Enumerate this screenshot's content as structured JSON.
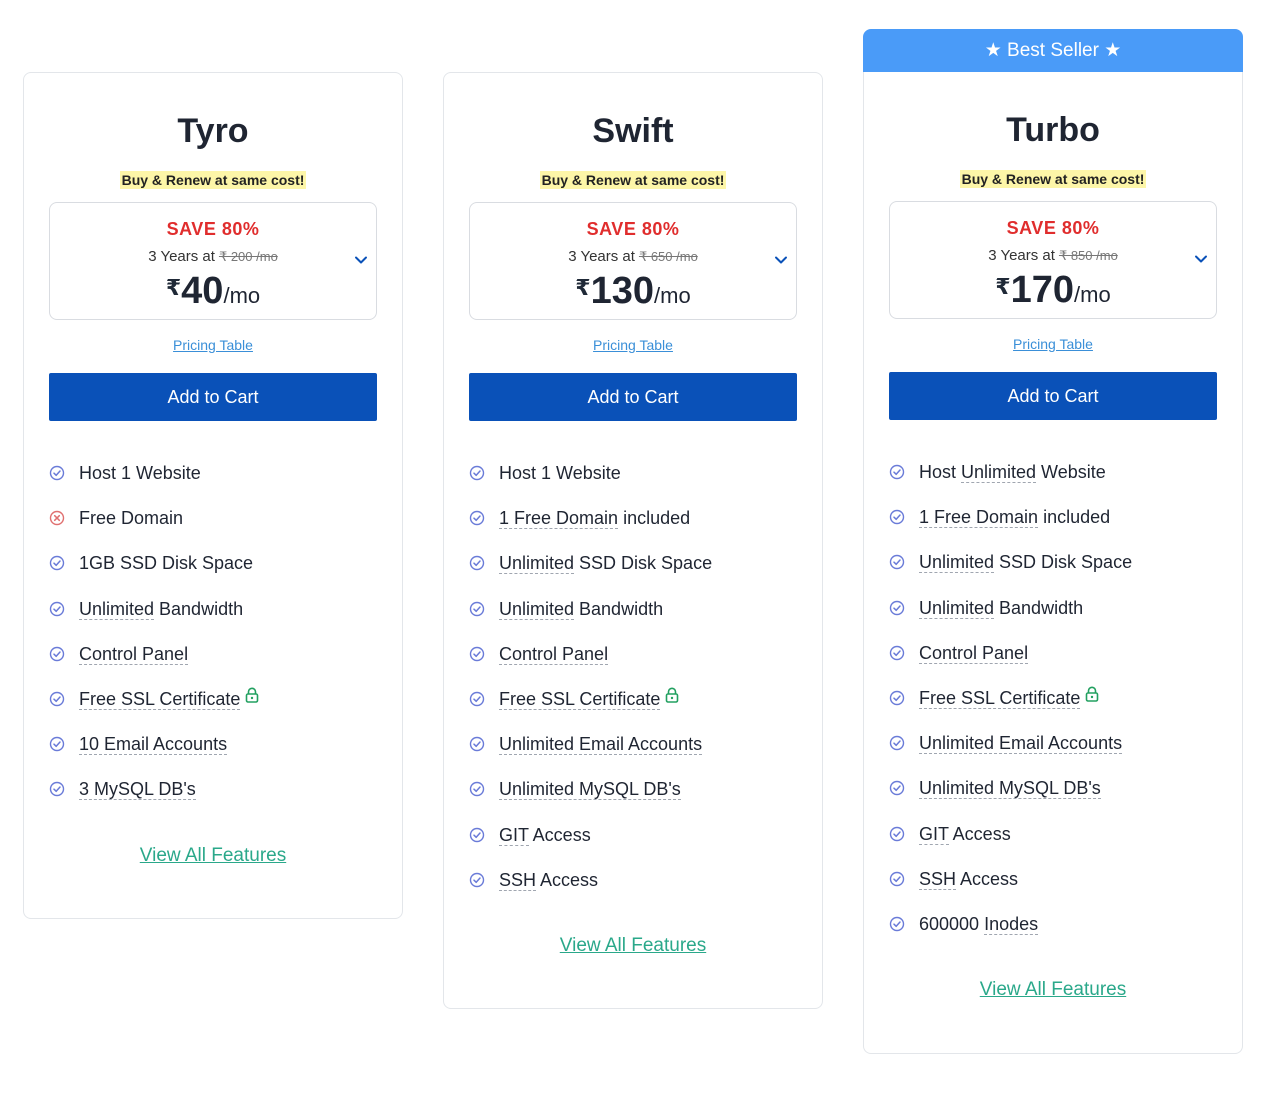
{
  "ribbon": {
    "text": "★ Best Seller ★"
  },
  "plans": [
    {
      "name": "Tyro",
      "tagline": "Buy & Renew at same cost!",
      "save": "SAVE 80%",
      "term": "3 Years at",
      "old_price": "₹ 200 /mo",
      "currency": "₹",
      "price": "40",
      "per": "/mo",
      "pricing_link": "Pricing Table",
      "cart_label": "Add to Cart",
      "view_all": "View All Features",
      "features": [
        {
          "pre": "Host 1 Website",
          "ul": "",
          "post": "",
          "icon": "check"
        },
        {
          "pre": "Free Domain",
          "ul": "",
          "post": "",
          "icon": "cross"
        },
        {
          "pre": "1GB SSD Disk Space",
          "ul": "",
          "post": "",
          "icon": "check"
        },
        {
          "pre": "",
          "ul": "Unlimited",
          "post": " Bandwidth",
          "icon": "check"
        },
        {
          "pre": "",
          "ul": "Control Panel",
          "post": "",
          "icon": "check"
        },
        {
          "pre": "",
          "ul": "Free SSL Certificate",
          "post": "",
          "icon": "check",
          "lock": true
        },
        {
          "pre": "",
          "ul": "10 Email Accounts",
          "post": "",
          "icon": "check"
        },
        {
          "pre": "",
          "ul": "3 MySQL DB's",
          "post": "",
          "icon": "check"
        }
      ]
    },
    {
      "name": "Swift",
      "tagline": "Buy & Renew at same cost!",
      "save": "SAVE 80%",
      "term": "3 Years at",
      "old_price": "₹ 650 /mo",
      "currency": "₹",
      "price": "130",
      "per": "/mo",
      "pricing_link": "Pricing Table",
      "cart_label": "Add to Cart",
      "view_all": "View All Features",
      "features": [
        {
          "pre": "Host 1 Website",
          "ul": "",
          "post": "",
          "icon": "check"
        },
        {
          "pre": "",
          "ul": "1 Free Domain",
          "post": " included",
          "icon": "check"
        },
        {
          "pre": "",
          "ul": "Unlimited",
          "post": " SSD Disk Space",
          "icon": "check"
        },
        {
          "pre": "",
          "ul": "Unlimited",
          "post": " Bandwidth",
          "icon": "check"
        },
        {
          "pre": "",
          "ul": "Control Panel",
          "post": "",
          "icon": "check"
        },
        {
          "pre": "",
          "ul": "Free SSL Certificate",
          "post": "",
          "icon": "check",
          "lock": true
        },
        {
          "pre": "",
          "ul": "Unlimited Email Accounts",
          "post": "",
          "icon": "check"
        },
        {
          "pre": "",
          "ul": "Unlimited MySQL DB's",
          "post": "",
          "icon": "check"
        },
        {
          "pre": "",
          "ul": "GIT",
          "post": " Access",
          "icon": "check"
        },
        {
          "pre": "",
          "ul": "SSH",
          "post": " Access",
          "icon": "check"
        }
      ]
    },
    {
      "name": "Turbo",
      "tagline": "Buy & Renew at same cost!",
      "save": "SAVE 80%",
      "term": "3 Years at",
      "old_price": "₹ 850 /mo",
      "currency": "₹",
      "price": "170",
      "per": "/mo",
      "pricing_link": "Pricing Table",
      "cart_label": "Add to Cart",
      "view_all": "View All Features",
      "features": [
        {
          "pre": "Host ",
          "ul": "Unlimited",
          "post": " Website",
          "icon": "check"
        },
        {
          "pre": "",
          "ul": "1 Free Domain",
          "post": " included",
          "icon": "check"
        },
        {
          "pre": "",
          "ul": "Unlimited",
          "post": " SSD Disk Space",
          "icon": "check"
        },
        {
          "pre": "",
          "ul": "Unlimited",
          "post": " Bandwidth",
          "icon": "check"
        },
        {
          "pre": "",
          "ul": "Control Panel",
          "post": "",
          "icon": "check"
        },
        {
          "pre": "",
          "ul": "Free SSL Certificate",
          "post": "",
          "icon": "check",
          "lock": true
        },
        {
          "pre": "",
          "ul": "Unlimited Email Accounts",
          "post": "",
          "icon": "check"
        },
        {
          "pre": "",
          "ul": "Unlimited MySQL DB's",
          "post": "",
          "icon": "check"
        },
        {
          "pre": "",
          "ul": "GIT",
          "post": " Access",
          "icon": "check"
        },
        {
          "pre": "",
          "ul": "SSH",
          "post": " Access",
          "icon": "check"
        },
        {
          "pre": "600000 ",
          "ul": "Inodes",
          "post": "",
          "icon": "check"
        }
      ]
    }
  ],
  "colors": {
    "ribbon": "#4a9bf8",
    "cart_button": "#0a51b8",
    "save": "#e02d2d",
    "tagline_highlight": "#fdf6a8",
    "view_all": "#2aa88a",
    "pricing_link": "#3a8fd8",
    "check_icon": "#6a7bd8",
    "cross_icon": "#e07070",
    "lock_icon": "#22a060"
  },
  "icons": {
    "check": "check-circle-icon",
    "cross": "cross-circle-icon",
    "lock": "lock-icon",
    "chevron": "chevron-down-icon"
  }
}
